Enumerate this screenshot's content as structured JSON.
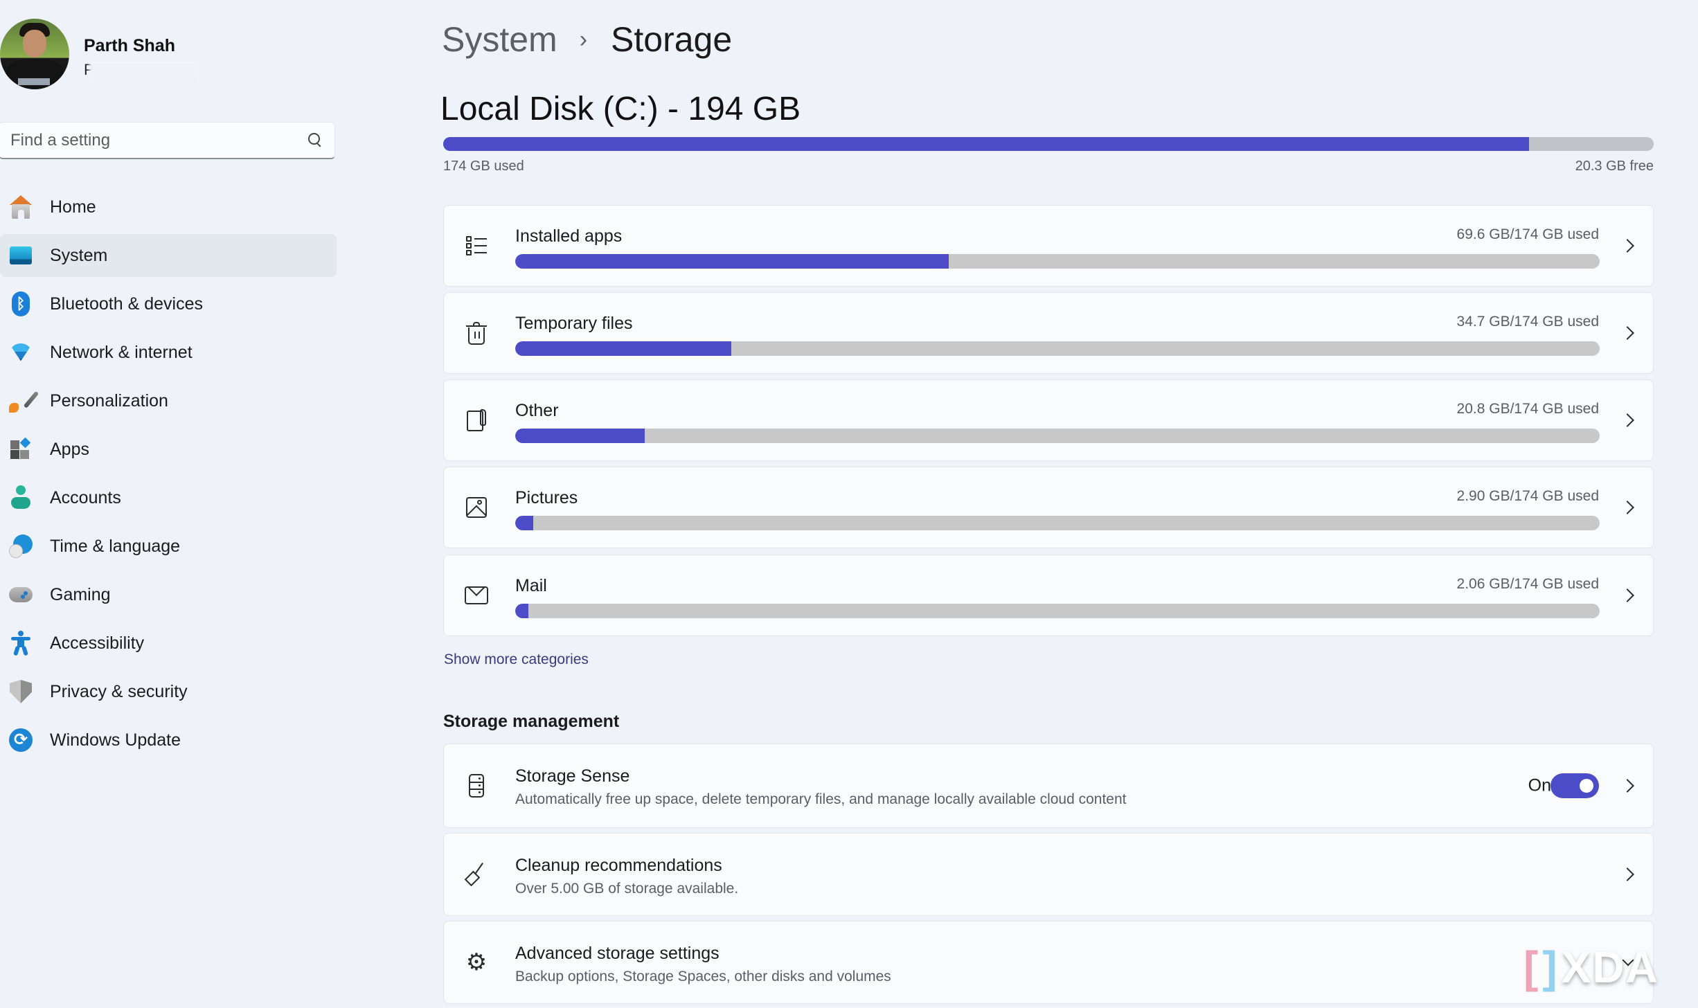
{
  "user": {
    "name": "Parth Shah",
    "email_visible": "P"
  },
  "search": {
    "placeholder": "Find a setting"
  },
  "sidebar": {
    "items": [
      {
        "label": "Home",
        "icon": "home-icon",
        "selected": false
      },
      {
        "label": "System",
        "icon": "system-icon",
        "selected": true
      },
      {
        "label": "Bluetooth & devices",
        "icon": "bluetooth-icon",
        "selected": false
      },
      {
        "label": "Network & internet",
        "icon": "wifi-icon",
        "selected": false
      },
      {
        "label": "Personalization",
        "icon": "paintbrush-icon",
        "selected": false
      },
      {
        "label": "Apps",
        "icon": "apps-icon",
        "selected": false
      },
      {
        "label": "Accounts",
        "icon": "person-icon",
        "selected": false
      },
      {
        "label": "Time & language",
        "icon": "globe-clock-icon",
        "selected": false
      },
      {
        "label": "Gaming",
        "icon": "gamepad-icon",
        "selected": false
      },
      {
        "label": "Accessibility",
        "icon": "accessibility-icon",
        "selected": false
      },
      {
        "label": "Privacy & security",
        "icon": "shield-icon",
        "selected": false
      },
      {
        "label": "Windows Update",
        "icon": "sync-icon",
        "selected": false
      }
    ]
  },
  "breadcrumb": {
    "parent": "System",
    "separator": "›",
    "current": "Storage"
  },
  "disk": {
    "title": "Local Disk (C:) - 194 GB",
    "used_label": "174 GB used",
    "free_label": "20.3 GB free",
    "used_gb": 174,
    "total_gb": 194
  },
  "categories": [
    {
      "name": "Installed apps",
      "usage": "69.6 GB/174 GB used",
      "used_gb": 69.6,
      "icon": "list-icon"
    },
    {
      "name": "Temporary files",
      "usage": "34.7 GB/174 GB used",
      "used_gb": 34.7,
      "icon": "trash-icon"
    },
    {
      "name": "Other",
      "usage": "20.8 GB/174 GB used",
      "used_gb": 20.8,
      "icon": "document-icon"
    },
    {
      "name": "Pictures",
      "usage": "2.90 GB/174 GB used",
      "used_gb": 2.9,
      "icon": "image-icon"
    },
    {
      "name": "Mail",
      "usage": "2.06 GB/174 GB used",
      "used_gb": 2.06,
      "icon": "mail-icon"
    }
  ],
  "categories_total_gb": 174,
  "show_more": "Show more categories",
  "management": {
    "title": "Storage management",
    "items": [
      {
        "name": "Storage Sense",
        "desc": "Automatically free up space, delete temporary files, and manage locally available cloud content",
        "toggle_label": "On",
        "toggle_on": true
      },
      {
        "name": "Cleanup recommendations",
        "desc": "Over 5.00 GB of storage available."
      },
      {
        "name": "Advanced storage settings",
        "desc": "Backup options, Storage Spaces, other disks and volumes"
      }
    ]
  },
  "watermark": "XDA",
  "colors": {
    "accent": "#4d4cc8",
    "bar_track": "#c8c8c8",
    "background": "#eff3f9",
    "card": "#f9fbfd",
    "link": "#3a3a82"
  }
}
